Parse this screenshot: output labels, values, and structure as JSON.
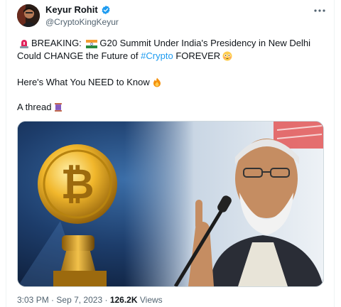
{
  "author": {
    "display_name": "Keyur Rohit",
    "handle": "@CryptoKingKeyur",
    "verified_icon": "verified-badge-icon",
    "more_icon": "more-options-icon"
  },
  "tweet": {
    "line1_prefix": "BREAKING:",
    "line1_text": "G20 Summit Under India's Presidency in New Delhi",
    "line2_before": "Could CHANGE the Future of",
    "hashtag": "#Crypto",
    "line2_after": "FOREVER",
    "line3": "Here's What You NEED to Know",
    "line4": "A thread",
    "emojis": {
      "siren": "rotating-light-icon",
      "flag": "india-flag-icon",
      "flushed": "flushed-face-icon",
      "fire": "fire-icon",
      "thread": "spool-of-thread-icon"
    }
  },
  "media": {
    "image": "bitcoin-coin-and-speaker-photo"
  },
  "meta": {
    "time": "3:03 PM",
    "separator": "·",
    "date": "Sep 7, 2023",
    "views_count": "126.2K",
    "views_label": "Views"
  },
  "colors": {
    "text": "#0f1419",
    "secondary": "#536471",
    "link": "#1d9bf0",
    "verified": "#1d9bf0"
  }
}
